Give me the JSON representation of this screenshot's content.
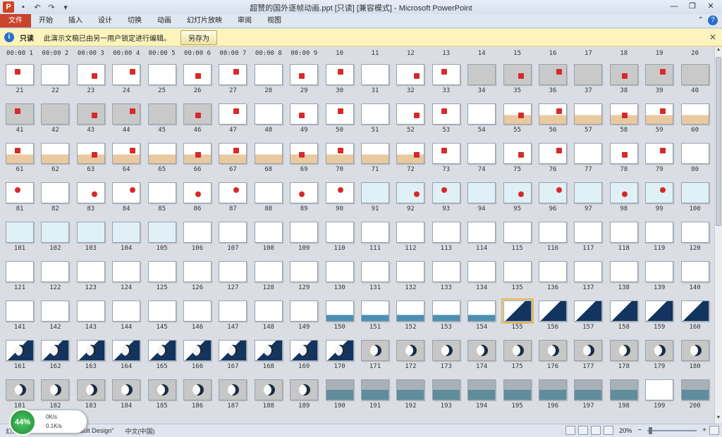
{
  "window": {
    "title": "超赞的国外逐帧动画.ppt [只读] [兼容模式] - Microsoft PowerPoint",
    "app_letter": "P"
  },
  "ribbon": {
    "tabs": [
      "文件",
      "开始",
      "插入",
      "设计",
      "切换",
      "动画",
      "幻灯片放映",
      "审阅",
      "视图"
    ]
  },
  "message_bar": {
    "title": "只读",
    "text": "此演示文稿已由另一用户锁定进行编辑。",
    "button": "另存为"
  },
  "sorter": {
    "top_labels": [
      "00:00 1",
      "00:00 2",
      "00:00 3",
      "00:00 4",
      "00:00 5",
      "00:00 6",
      "00:00 7",
      "00:00 8",
      "00:00 9",
      "10",
      "11",
      "12",
      "13",
      "14",
      "15",
      "16",
      "17",
      "18",
      "19",
      "20"
    ],
    "rows": [
      {
        "labels": [
          "21",
          "22",
          "23",
          "24",
          "25",
          "26",
          "27",
          "28",
          "29",
          "30",
          "31",
          "32",
          "33",
          "34",
          "35",
          "36",
          "37",
          "38",
          "39",
          "40"
        ],
        "style": "mixed1"
      },
      {
        "labels": [
          "41",
          "42",
          "43",
          "44",
          "45",
          "46",
          "47",
          "48",
          "49",
          "50",
          "51",
          "52",
          "53",
          "54",
          "55",
          "56",
          "57",
          "58",
          "59",
          "60"
        ],
        "style": "mixed2"
      },
      {
        "labels": [
          "61",
          "62",
          "63",
          "64",
          "65",
          "66",
          "67",
          "68",
          "69",
          "70",
          "71",
          "72",
          "73",
          "74",
          "75",
          "76",
          "77",
          "78",
          "79",
          "80"
        ],
        "style": "tan"
      },
      {
        "labels": [
          "81",
          "82",
          "83",
          "84",
          "85",
          "86",
          "87",
          "88",
          "89",
          "90",
          "91",
          "92",
          "93",
          "94",
          "95",
          "96",
          "97",
          "98",
          "99",
          "100"
        ],
        "style": "flower"
      },
      {
        "labels": [
          "101",
          "102",
          "103",
          "104",
          "105",
          "106",
          "107",
          "108",
          "109",
          "110",
          "111",
          "112",
          "113",
          "114",
          "115",
          "116",
          "117",
          "118",
          "119",
          "120"
        ],
        "style": "light"
      },
      {
        "labels": [
          "121",
          "122",
          "123",
          "124",
          "125",
          "126",
          "127",
          "128",
          "129",
          "130",
          "131",
          "132",
          "133",
          "134",
          "135",
          "136",
          "137",
          "138",
          "139",
          "140"
        ],
        "style": "white"
      },
      {
        "labels": [
          "141",
          "142",
          "143",
          "144",
          "145",
          "146",
          "147",
          "148",
          "149",
          "150",
          "151",
          "152",
          "153",
          "154",
          "155",
          "156",
          "157",
          "158",
          "159",
          "160"
        ],
        "style": "sky"
      },
      {
        "labels": [
          "161",
          "162",
          "163",
          "164",
          "165",
          "166",
          "167",
          "168",
          "169",
          "170",
          "171",
          "172",
          "173",
          "174",
          "175",
          "176",
          "177",
          "178",
          "179",
          "180"
        ],
        "style": "moon"
      },
      {
        "labels": [
          "181",
          "182",
          "183",
          "184",
          "185",
          "186",
          "187",
          "188",
          "189",
          "190",
          "191",
          "192",
          "193",
          "194",
          "195",
          "196",
          "197",
          "198",
          "199",
          "200"
        ],
        "style": "sea"
      }
    ],
    "selected_slide": "155"
  },
  "statusbar": {
    "slide_info": "幻灯",
    "theme": "\"Default Design\"",
    "language": "中文(中国)",
    "zoom": "20%",
    "zoom_minus": "−",
    "zoom_plus": "+"
  },
  "network": {
    "percent": "44%",
    "up": "0K/s",
    "down": "0.1K/s"
  },
  "colors": {
    "file_tab": "#c8442a",
    "message_bar": "#fdf3bd",
    "selection": "#e9b949"
  }
}
